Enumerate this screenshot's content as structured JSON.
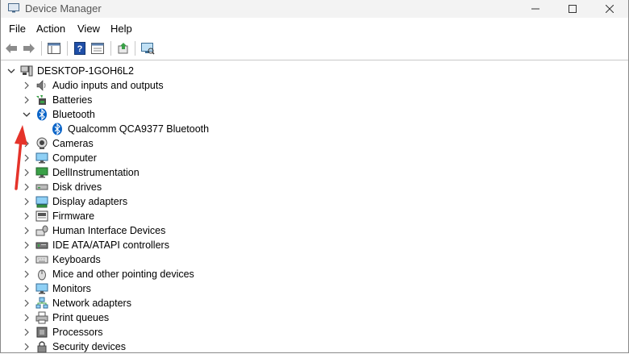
{
  "window": {
    "title": "Device Manager"
  },
  "menu": {
    "file": "File",
    "action": "Action",
    "view": "View",
    "help": "Help"
  },
  "tree": {
    "root": "DESKTOP-1GOH6L2",
    "categories": [
      {
        "label": "Audio inputs and outputs",
        "icon": "speaker-icon",
        "expanded": false
      },
      {
        "label": "Batteries",
        "icon": "battery-icon",
        "expanded": false
      },
      {
        "label": "Bluetooth",
        "icon": "bluetooth-icon",
        "expanded": true
      },
      {
        "label": "Cameras",
        "icon": "camera-icon",
        "expanded": false
      },
      {
        "label": "Computer",
        "icon": "monitor-icon",
        "expanded": false
      },
      {
        "label": "DellInstrumentation",
        "icon": "monitor-icon",
        "expanded": false
      },
      {
        "label": "Disk drives",
        "icon": "disk-icon",
        "expanded": false
      },
      {
        "label": "Display adapters",
        "icon": "display-adapter-icon",
        "expanded": false
      },
      {
        "label": "Firmware",
        "icon": "firmware-icon",
        "expanded": false
      },
      {
        "label": "Human Interface Devices",
        "icon": "hid-icon",
        "expanded": false
      },
      {
        "label": "IDE ATA/ATAPI controllers",
        "icon": "ide-icon",
        "expanded": false
      },
      {
        "label": "Keyboards",
        "icon": "keyboard-icon",
        "expanded": false
      },
      {
        "label": "Mice and other pointing devices",
        "icon": "mouse-icon",
        "expanded": false
      },
      {
        "label": "Monitors",
        "icon": "monitor-icon",
        "expanded": false
      },
      {
        "label": "Network adapters",
        "icon": "network-icon",
        "expanded": false
      },
      {
        "label": "Print queues",
        "icon": "printer-icon",
        "expanded": false
      },
      {
        "label": "Processors",
        "icon": "processor-icon",
        "expanded": false
      },
      {
        "label": "Security devices",
        "icon": "security-icon",
        "expanded": false
      }
    ],
    "bluetooth_children": [
      {
        "label": "Qualcomm QCA9377 Bluetooth",
        "icon": "bluetooth-icon"
      }
    ]
  },
  "colors": {
    "annotation_arrow": "#e5332a",
    "bluetooth": "#0a64c8"
  }
}
